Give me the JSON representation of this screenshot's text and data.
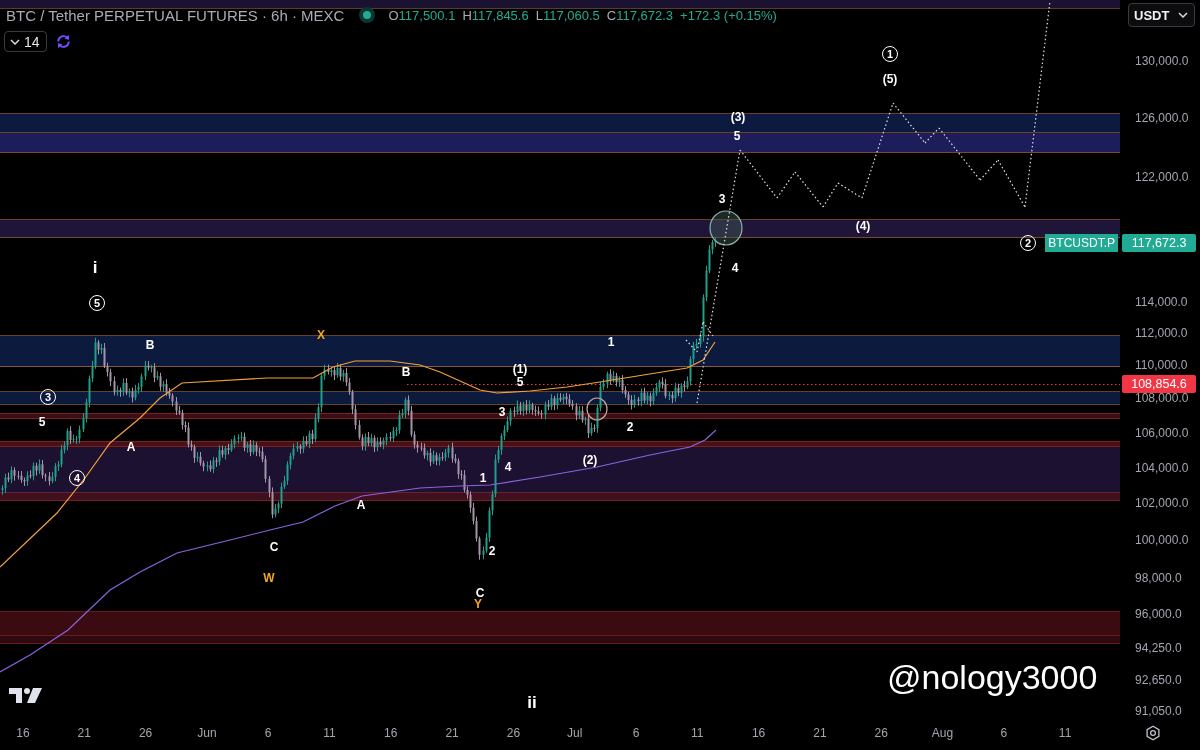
{
  "header": {
    "title": "BTC / Tether PERPETUAL FUTURES · 6h · MEXC",
    "ohlc": [
      {
        "label": "O",
        "value": "117,500.1"
      },
      {
        "label": "H",
        "value": "117,845.6"
      },
      {
        "label": "L",
        "value": "117,060.5"
      },
      {
        "label": "C",
        "value": "117,672.3"
      }
    ],
    "change": "+172.3 (+0.15%)"
  },
  "indicators_button": {
    "count": "14"
  },
  "wave_labels": [
    {
      "text": "1",
      "kind": "circled",
      "color": "#ffffff"
    },
    {
      "text": "(5)",
      "kind": "plain",
      "color": "#ffffff"
    },
    {
      "text": "(3)",
      "kind": "plain",
      "color": "#ffffff"
    },
    {
      "text": "5",
      "kind": "plain",
      "color": "#ffffff"
    },
    {
      "text": "3",
      "kind": "plain",
      "color": "#ffffff"
    },
    {
      "text": "(4)",
      "kind": "plain",
      "color": "#ffffff"
    },
    {
      "text": "2",
      "kind": "circled",
      "color": "#ffffff"
    },
    {
      "text": "i",
      "kind": "roman",
      "color": "#ffffff"
    },
    {
      "text": "4",
      "kind": "plain",
      "color": "#ffffff"
    },
    {
      "text": "5",
      "kind": "circled",
      "color": "#ffffff"
    },
    {
      "text": "X",
      "kind": "plain",
      "color": "#f5a623"
    },
    {
      "text": "1",
      "kind": "plain",
      "color": "#ffffff"
    },
    {
      "text": "B",
      "kind": "plain",
      "color": "#ffffff"
    },
    {
      "text": "(1)",
      "kind": "plain",
      "color": "#ffffff"
    },
    {
      "text": "B",
      "kind": "plain",
      "color": "#ffffff"
    },
    {
      "text": "5",
      "kind": "plain",
      "color": "#ffffff"
    },
    {
      "text": "3",
      "kind": "circled",
      "color": "#ffffff"
    },
    {
      "text": "3",
      "kind": "plain",
      "color": "#ffffff"
    },
    {
      "text": "5",
      "kind": "plain",
      "color": "#ffffff"
    },
    {
      "text": "2",
      "kind": "plain",
      "color": "#ffffff"
    },
    {
      "text": "A",
      "kind": "plain",
      "color": "#ffffff"
    },
    {
      "text": "(2)",
      "kind": "plain",
      "color": "#ffffff"
    },
    {
      "text": "4",
      "kind": "plain",
      "color": "#ffffff"
    },
    {
      "text": "4",
      "kind": "circled",
      "color": "#ffffff"
    },
    {
      "text": "1",
      "kind": "plain",
      "color": "#ffffff"
    },
    {
      "text": "A",
      "kind": "plain",
      "color": "#ffffff"
    },
    {
      "text": "C",
      "kind": "plain",
      "color": "#ffffff"
    },
    {
      "text": "2",
      "kind": "plain",
      "color": "#ffffff"
    },
    {
      "text": "W",
      "kind": "plain",
      "color": "#f5a623"
    },
    {
      "text": "C",
      "kind": "plain",
      "color": "#ffffff"
    },
    {
      "text": "Y",
      "kind": "plain",
      "color": "#f5a623"
    },
    {
      "text": "ii",
      "kind": "roman",
      "color": "#ffffff"
    }
  ],
  "price_tags": [
    {
      "symbol": "BTCUSDT.P",
      "price": "117,672.3",
      "color": "#22ab94"
    },
    {
      "price": "108,854.6",
      "color": "#f23645"
    }
  ],
  "author_handle": "@nology3000",
  "price_axis": {
    "currency": "USDT",
    "labels": [
      "130,000.0",
      "126,000.0",
      "122,000.0",
      "114,000.0",
      "112,000.0",
      "110,000.0",
      "108,000.0",
      "106,000.0",
      "104,000.0",
      "102,000.0",
      "100,000.0",
      "98,000.0",
      "96,000.0",
      "94,250.0",
      "92,650.0",
      "91,050.0"
    ]
  },
  "time_axis": {
    "labels": [
      "16",
      "21",
      "26",
      "Jun",
      "6",
      "11",
      "16",
      "21",
      "26",
      "Jul",
      "6",
      "11",
      "16",
      "21",
      "26",
      "Aug",
      "6",
      "11"
    ]
  }
}
